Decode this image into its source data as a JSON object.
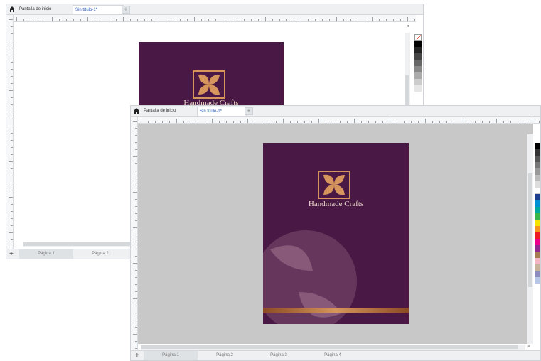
{
  "app": {
    "back_window": {
      "tabs": [
        {
          "label": "Pantalla de inicio"
        },
        {
          "label": "Sin título-1*"
        }
      ],
      "pages": [
        {
          "label": "Página 1"
        },
        {
          "label": "Página 2"
        }
      ],
      "ruler_unit": "mm"
    },
    "front_window": {
      "tabs": [
        {
          "label": "Pantalla de inicio"
        },
        {
          "label": "Sin título-1*"
        }
      ],
      "pages": [
        {
          "label": "Página 1"
        },
        {
          "label": "Página 2"
        },
        {
          "label": "Página 3"
        },
        {
          "label": "Página 4"
        }
      ],
      "ruler_unit": "mm"
    },
    "document": {
      "title": "Handmade Crafts"
    },
    "colors": {
      "document_bg": "#4a1844",
      "logo_color": "#d6955c",
      "canvas_gray": "#c8c8c8",
      "tab_active_text": "#2a5db0"
    },
    "icons": {
      "home": "home-icon",
      "add_tab": "plus-icon",
      "add_page": "plus-icon",
      "no_color": "no-color-icon",
      "zoom": "zoom-icon"
    }
  }
}
